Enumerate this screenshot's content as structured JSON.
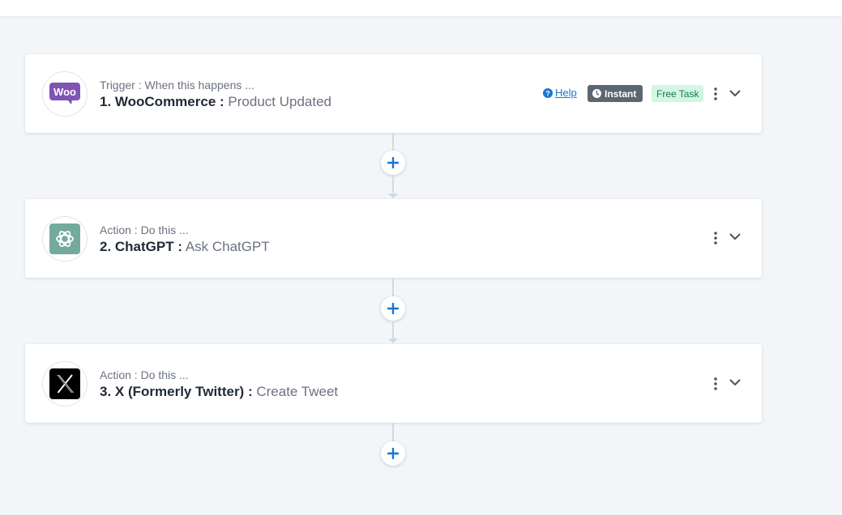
{
  "steps": [
    {
      "kind": "Trigger : When this happens ...",
      "app": "1. WooCommerce :",
      "event": "Product Updated",
      "logo": "woocommerce-logo",
      "logo_text": "Woo",
      "help_label": "Help",
      "instant_label": "Instant",
      "free_task_label": "Free Task"
    },
    {
      "kind": "Action : Do this ...",
      "app": "2. ChatGPT :",
      "event": "Ask ChatGPT",
      "logo": "chatgpt-logo"
    },
    {
      "kind": "Action : Do this ...",
      "app": "3. X (Formerly Twitter) :",
      "event": "Create Tweet",
      "logo": "x-logo"
    }
  ],
  "colors": {
    "accent": "#1976d2",
    "woo_purple": "#7f54b3",
    "chatgpt_green": "#74aa9c",
    "instant_bg": "#5c6670",
    "free_bg": "#d3f5e4",
    "free_text": "#137a4b"
  },
  "icons": {
    "add": "plus-icon",
    "menu": "kebab-menu-icon",
    "expand": "chevron-down-icon",
    "help": "question-circle-icon",
    "instant": "clock-icon"
  }
}
